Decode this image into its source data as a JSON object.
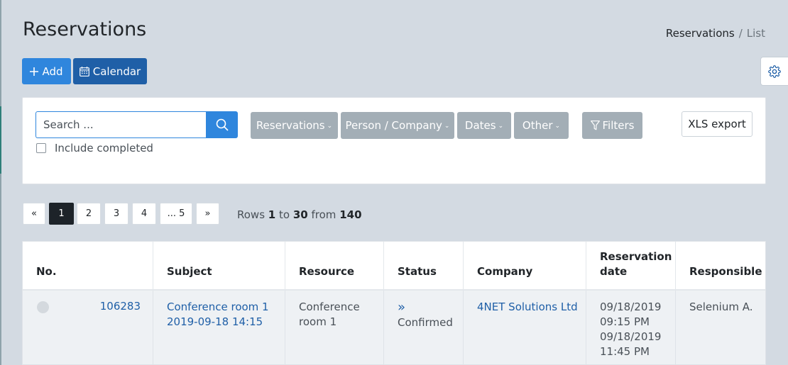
{
  "page": {
    "title": "Reservations",
    "breadcrumb": {
      "parent": "Reservations",
      "separator": "/",
      "current": "List"
    }
  },
  "toolbar": {
    "add_label": "Add",
    "calendar_label": "Calendar"
  },
  "filters": {
    "search_placeholder": "Search ...",
    "include_completed_label": "Include completed",
    "include_completed_checked": false,
    "dropdowns": [
      "Reservations",
      "Person / Company",
      "Dates",
      "Other"
    ],
    "filters_label": "Filters",
    "xls_export_label": "XLS export"
  },
  "pagination": {
    "prev": "«",
    "pages": [
      "1",
      "2",
      "3",
      "4",
      "... 5"
    ],
    "next": "»",
    "active_page": "1",
    "rows_prefix": "Rows",
    "rows_from": "1",
    "rows_to_word": "to",
    "rows_to": "30",
    "rows_from_word": "from",
    "rows_total": "140"
  },
  "table": {
    "columns": [
      "No.",
      "Subject",
      "Resource",
      "Status",
      "Company",
      "Reservation date",
      "Responsible"
    ],
    "rows": [
      {
        "no": "106283",
        "subject_line1": "Conference room 1",
        "subject_line2": "2019-09-18 14:15",
        "resource": "Conference room 1",
        "status_icon": "»",
        "status": "Confirmed",
        "company": "4NET Solutions Ltd",
        "date_start_day": "09/18/2019",
        "date_start_time": "09:15 PM",
        "date_end_day": "09/18/2019",
        "date_end_time": "11:45 PM",
        "responsible": "Selenium A."
      }
    ]
  },
  "colors": {
    "primary": "#2f86dd",
    "primary_dark": "#1f5fa7",
    "dropdown_gray": "#a3aeb6",
    "background": "#d3dae2"
  }
}
